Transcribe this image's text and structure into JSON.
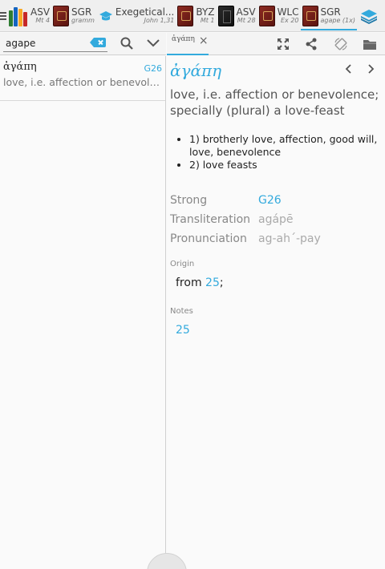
{
  "tabs": [
    {
      "name": "ASV",
      "ref": "Mt 4",
      "book": "shelf"
    },
    {
      "name": "SGR",
      "ref": "gramm",
      "book": "red"
    },
    {
      "name": "Exegetical...",
      "ref": "John 1,31",
      "book": "cap"
    },
    {
      "name": "BYZ",
      "ref": "Mt 1",
      "book": "red"
    },
    {
      "name": "ASV",
      "ref": "Mt 28",
      "book": "dark"
    },
    {
      "name": "WLC",
      "ref": "Ex 20",
      "book": "red"
    },
    {
      "name": "SGR",
      "ref": "agape (1x)",
      "book": "red",
      "active": true
    }
  ],
  "search": {
    "value": "agape"
  },
  "results": [
    {
      "greek": "ἀγάπη",
      "code": "G26",
      "definition": "love, i.e. affection or benevolence; specially (plural) a love-feast"
    }
  ],
  "detail_tab": {
    "label": "ἀγάπη",
    "close": "×"
  },
  "entry": {
    "headword": "ἀγάπη",
    "summary": "love, i.e. affection or benevolence; specially (plural) a love-feast",
    "senses": [
      "1) brotherly love, affection, good will, love, benevolence",
      "2) love feasts"
    ],
    "strong_label": "Strong",
    "strong_value": "G26",
    "translit_label": "Transliteration",
    "translit_value": "agápē",
    "pron_label": "Pronunciation",
    "pron_value": "ag-ah´-pay",
    "origin_label": "Origin",
    "origin_prefix": "from ",
    "origin_link": "25",
    "origin_suffix": ";",
    "notes_label": "Notes",
    "notes_value": "25"
  },
  "colors": {
    "accent": "#33aadd",
    "book_red": "#8e2b22"
  }
}
